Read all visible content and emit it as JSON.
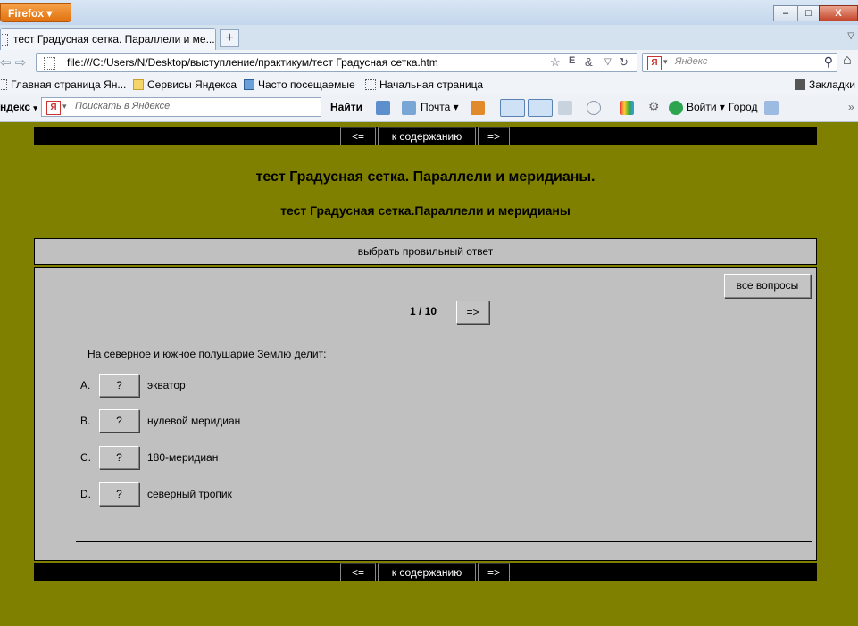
{
  "browser": {
    "menu_button": "Firefox",
    "window_controls": {
      "minimize": "–",
      "maximize": "□",
      "close": "X"
    },
    "tab": {
      "title": "тест Градусная сетка. Параллели и ме...",
      "close": "×"
    },
    "new_tab": "+",
    "tab_list": "▽",
    "nav_arrows": "⇦ ⇨",
    "url": "file:///C:/Users/N/Desktop/выступление/практикум/тест Градусная сетка.htm",
    "search_placeholder": "Яндекс",
    "search_logo": "Я",
    "bookmarks": [
      {
        "label": "Главная страница Ян..."
      },
      {
        "label": "Сервисы Яндекса"
      },
      {
        "label": "Часто посещаемые"
      },
      {
        "label": "Начальная страница"
      }
    ],
    "bookmarks_menu": "Закладки",
    "yandex_bar": {
      "brand": "ндекс",
      "brand_arrow": "▾",
      "search_placeholder": "Поискать в Яндексе",
      "find": "Найти",
      "mail": "Почта",
      "login": "Войти",
      "city": "Город"
    },
    "colors": {
      "tab_strip": "#d4e1ef",
      "toolbar": "#f0f4f9",
      "firefox_button": "#e2710f"
    }
  },
  "page": {
    "background": "#808000",
    "nav": {
      "prev": "<=",
      "contents": "к содержанию",
      "next": "=>"
    },
    "title": "тест Градусная сетка. Параллели и меридианы.",
    "subtitle": "тест Градусная сетка.Параллели и меридианы",
    "instruction": "выбрать провильный ответ",
    "all_questions_button": "все вопросы",
    "counter": "1 / 10",
    "next_question_button": "=>",
    "question": "На северное и южное полушарие Землю делит:",
    "options": [
      {
        "letter": "A.",
        "button": "?",
        "text": "экватор"
      },
      {
        "letter": "B.",
        "button": "?",
        "text": "нулевой меридиан"
      },
      {
        "letter": "C.",
        "button": "?",
        "text": "180-меридиан"
      },
      {
        "letter": "D.",
        "button": "?",
        "text": "северный тропик"
      }
    ]
  }
}
